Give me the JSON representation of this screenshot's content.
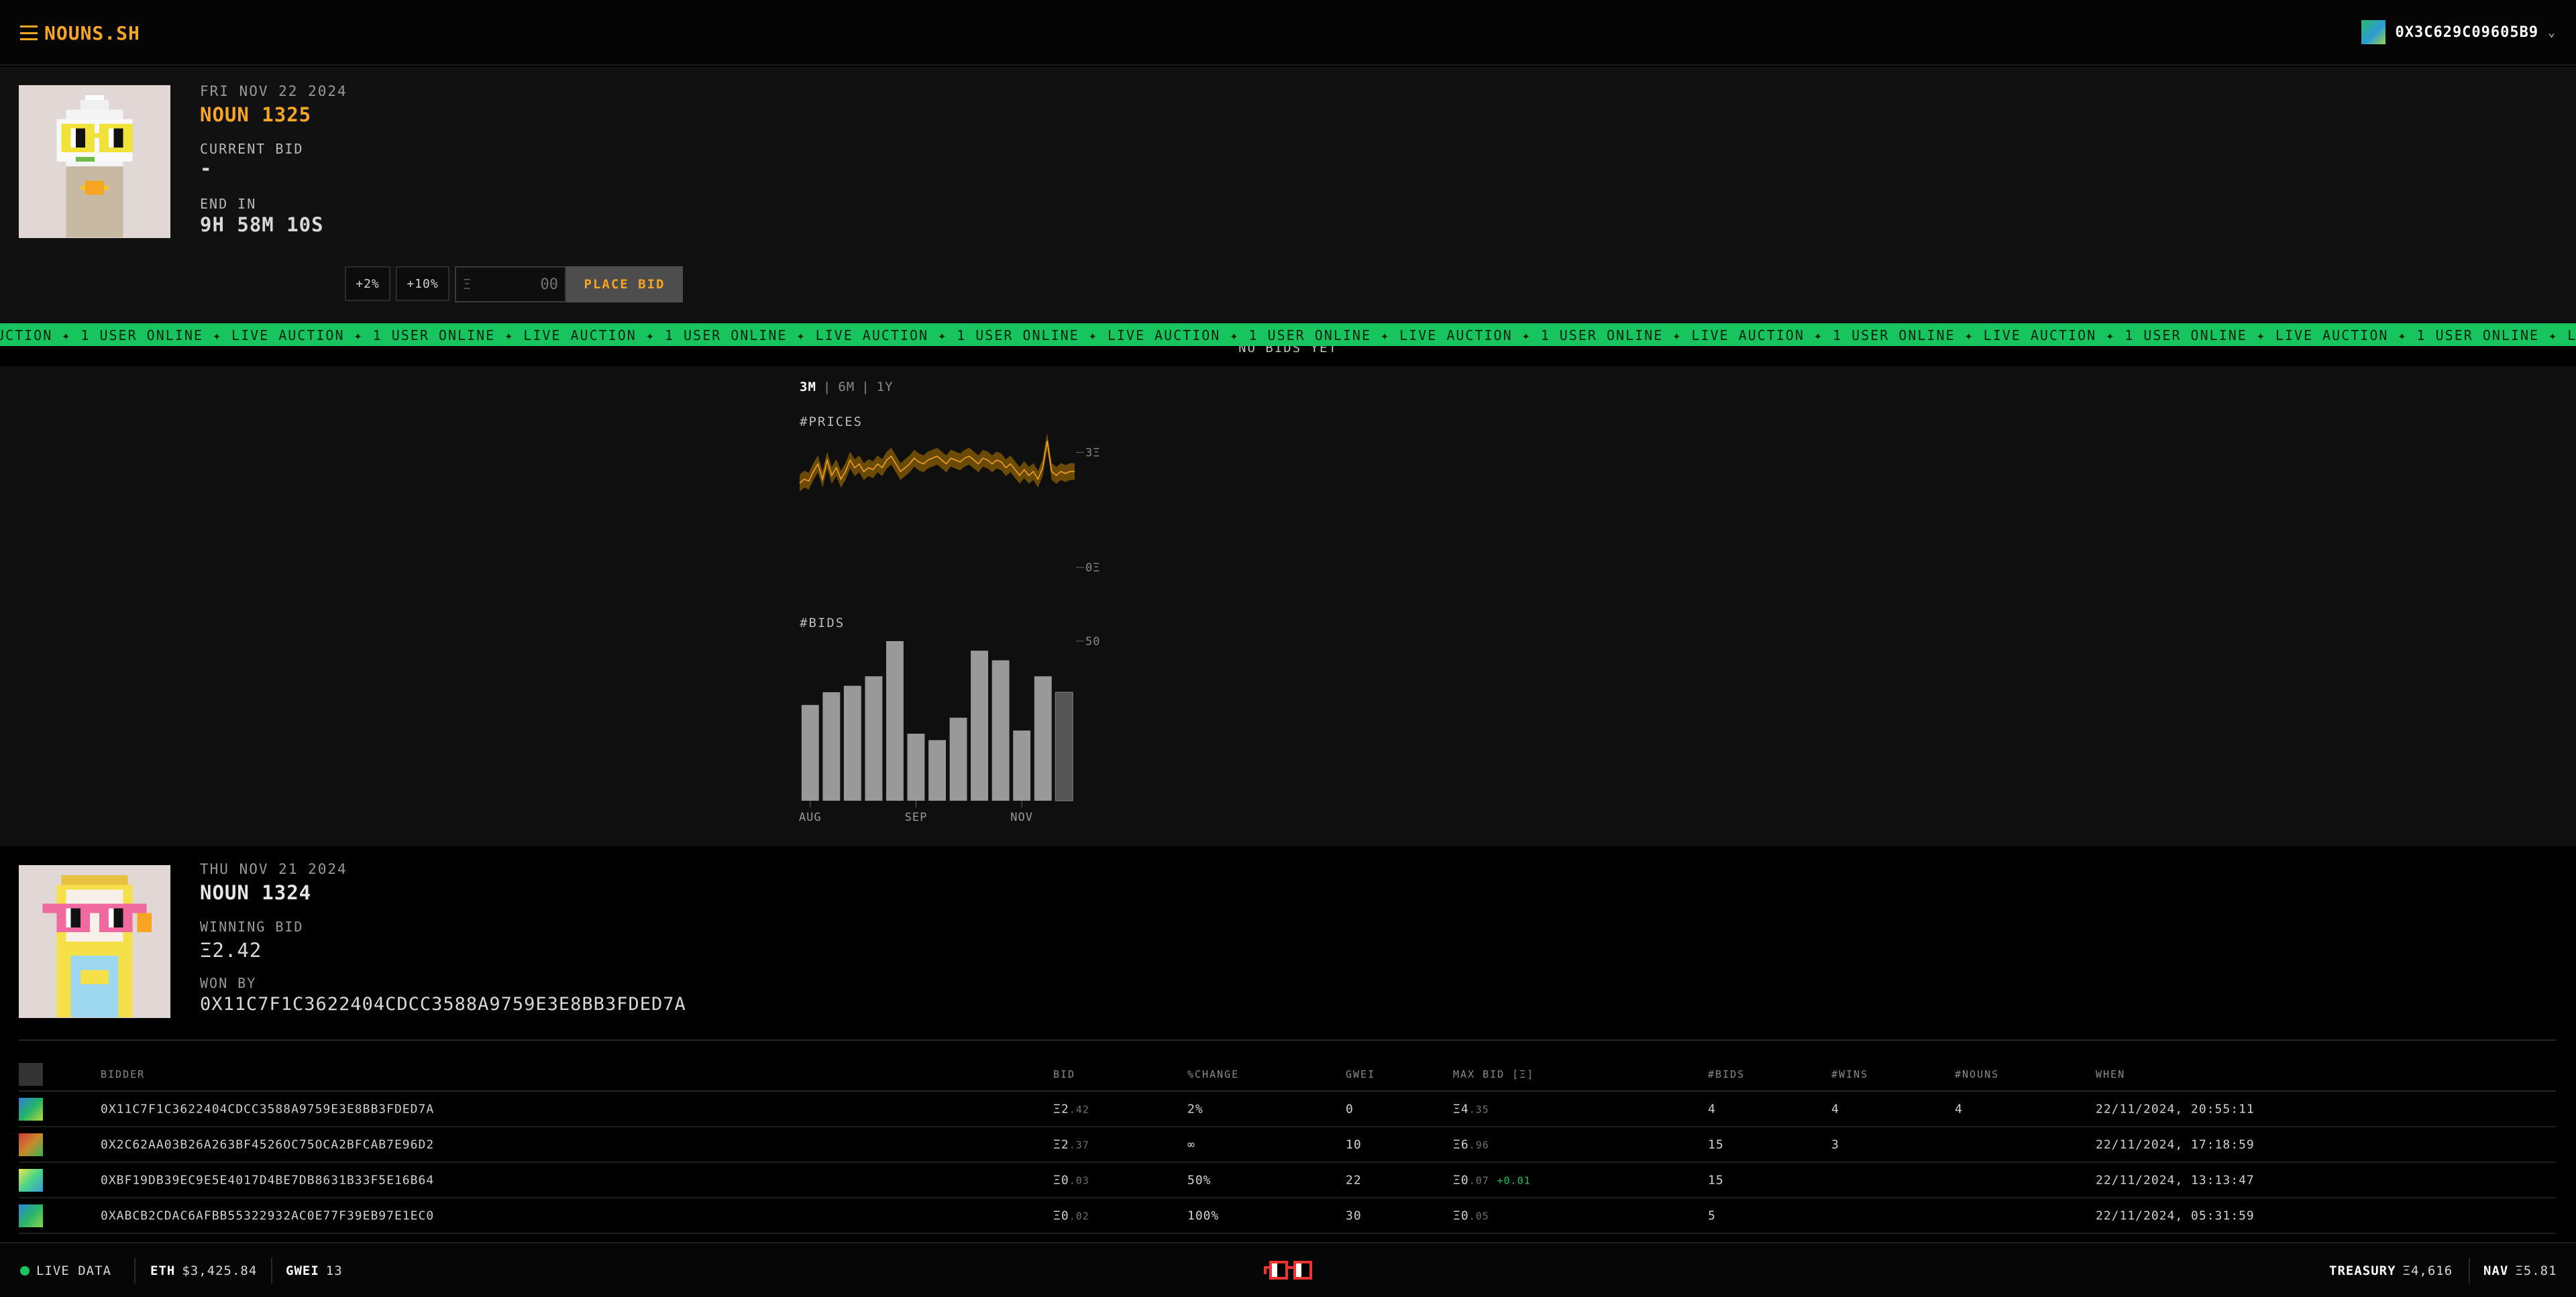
{
  "header": {
    "logo": "NOUNS.SH",
    "wallet_address": "0X3C629C09605B9",
    "wallet_chevron": "⌄"
  },
  "current_auction": {
    "date": "FRI NOV 22 2024",
    "title": "NOUN 1325",
    "current_bid_label": "CURRENT BID",
    "current_bid_value": "-",
    "end_label": "END IN",
    "end_value": "9H 58M 10S",
    "plus2": "+2%",
    "plus10": "+10%",
    "eth_symbol": "Ξ",
    "bid_placeholder": "00",
    "place_bid": "PLACE BID",
    "no_bids": "NO BIDS YET"
  },
  "ticker": {
    "text": "UCTION ✦ 1 USER ONLINE ✦ LIVE AUCTION ✦ 1 USER ONLINE ✦ LIVE AUCTION ✦ 1 USER ONLINE ✦ LIVE AUCTION ✦ 1 USER ONLINE ✦ LIVE AUCTION ✦ 1 USER ONLINE ✦ LIVE AUCTION ✦ 1 USER ONLINE ✦ LIVE AUCTION ✦ 1 USER ONLINE ✦ LIVE AUCTION ✦ 1 USER ONLINE ✦ LIVE AUCTION ✦ 1 USER ONLINE ✦ LIVE AUCTION ✦ 1 USER ONLINE ✦ LIVE AUCTION ✦ 1 USER ONLINE ✦ LIVE AUCTION ✦ 1 USER ONLINE ✦ LIVE AUCTION ✦ 1 USER ONLINE ✦ LIV"
  },
  "range_tabs": [
    "3M",
    "6M",
    "1Y"
  ],
  "range_sep": "|",
  "chart_data": [
    {
      "type": "area",
      "title": "#PRICES",
      "y_ticks": [
        "3Ξ",
        "0Ξ"
      ],
      "ylim": [
        0,
        3.5
      ],
      "color": "#f6a623",
      "band_color": "#6b4a06",
      "values": [
        2.2,
        2.3,
        2.25,
        2.5,
        2.7,
        2.3,
        2.8,
        2.4,
        2.6,
        2.3,
        2.5,
        2.8,
        2.6,
        2.7,
        2.5,
        2.6,
        2.55,
        2.7,
        2.6,
        2.8,
        2.9,
        2.7,
        2.5,
        2.6,
        2.7,
        2.85,
        2.75,
        2.7,
        2.8,
        2.85,
        2.9,
        2.8,
        2.7,
        2.85,
        2.8,
        2.75,
        2.85,
        2.9,
        2.8,
        2.7,
        2.85,
        2.8,
        2.7,
        2.8,
        2.75,
        2.6,
        2.7,
        2.55,
        2.4,
        2.55,
        2.4,
        2.5,
        2.3,
        2.6,
        3.3,
        2.5,
        2.4,
        2.5,
        2.45,
        2.5,
        2.5
      ]
    },
    {
      "type": "bar",
      "title": "#BIDS",
      "y_ticks": [
        "50"
      ],
      "ylim": [
        0,
        50
      ],
      "x_ticks": [
        "AUG",
        "SEP",
        "NOV"
      ],
      "bar_color": "#999999",
      "last_bar_color": "#555555",
      "values": [
        30,
        34,
        36,
        39,
        50,
        21,
        19,
        26,
        47,
        44,
        22,
        39,
        34
      ]
    }
  ],
  "previous_auction": {
    "date": "THU NOV 21 2024",
    "title": "NOUN 1324",
    "winning_bid_label": "WINNING BID",
    "winning_bid_value": "Ξ2.42",
    "won_by_label": "WON BY",
    "won_by_value": "0X11C7F1C3622404CDCC3588A9759E3E8BB3FDED7A"
  },
  "table": {
    "headers": {
      "bidder": "BIDDER",
      "bid": "BID",
      "change": "%CHANGE",
      "gwei": "GWEI",
      "max_bid": "MAX BID [Ξ]",
      "bids": "#BIDS",
      "wins": "#WINS",
      "nouns": "#NOUNS",
      "when": "WHEN"
    },
    "rows": [
      {
        "bidder": "0X11C7F1C3622404CDCC3588A9759E3E8BB3FDED7A",
        "bid_main": "Ξ2",
        "bid_dec": ".42",
        "change": "2%",
        "gwei": "0",
        "max_main": "Ξ4",
        "max_dec": ".35",
        "max_extra": "",
        "bids": "4",
        "wins": "4",
        "nouns": "4",
        "when": "22/11/2024, 20:55:11",
        "swatch": "linear-gradient(135deg,#2d7fd6,#24b36a,#b6d93a)"
      },
      {
        "bidder": "0X2C62AA03B26A263BF4526OC75OCA2BFCAB7E96D2",
        "bid_main": "Ξ2",
        "bid_dec": ".37",
        "change": "∞",
        "gwei": "10",
        "max_main": "Ξ6",
        "max_dec": ".96",
        "max_extra": "",
        "bids": "15",
        "wins": "3",
        "nouns": "",
        "when": "22/11/2024, 17:18:59",
        "swatch": "linear-gradient(135deg,#d43a3a,#c88a2a,#3ab35a)"
      },
      {
        "bidder": "0XBF19DB39EC9E5E4017D4BE7DB8631B33F5E16B64",
        "bid_main": "Ξ0",
        "bid_dec": ".03",
        "change": "50%",
        "gwei": "22",
        "max_main": "Ξ0",
        "max_dec": ".07",
        "max_extra": "+0.01",
        "bids": "15",
        "wins": "",
        "nouns": "",
        "when": "22/11/2024, 13:13:47",
        "swatch": "linear-gradient(135deg,#e8e84a,#4ad48a,#3a9ad6)"
      },
      {
        "bidder": "0XABCB2CDAC6AFBB55322932AC0E77F39EB97E1EC0",
        "bid_main": "Ξ0",
        "bid_dec": ".02",
        "change": "100%",
        "gwei": "30",
        "max_main": "Ξ0",
        "max_dec": ".05",
        "max_extra": "",
        "bids": "5",
        "wins": "",
        "nouns": "",
        "when": "22/11/2024, 05:31:59",
        "swatch": "linear-gradient(135deg,#2a8ad6,#2ab46a,#8ad64a)"
      }
    ]
  },
  "footer": {
    "live_label": "LIVE DATA",
    "eth_label": "ETH",
    "eth_value": "$3,425.84",
    "gwei_label": "GWEI",
    "gwei_value": "13",
    "treasury_label": "TREASURY",
    "treasury_value": "Ξ4,616",
    "nav_label": "NAV",
    "nav_value": "Ξ5.81"
  },
  "colors": {
    "accent": "#f6a623",
    "ticker": "#17c45d",
    "noun_bg": "#e1d7d5"
  }
}
